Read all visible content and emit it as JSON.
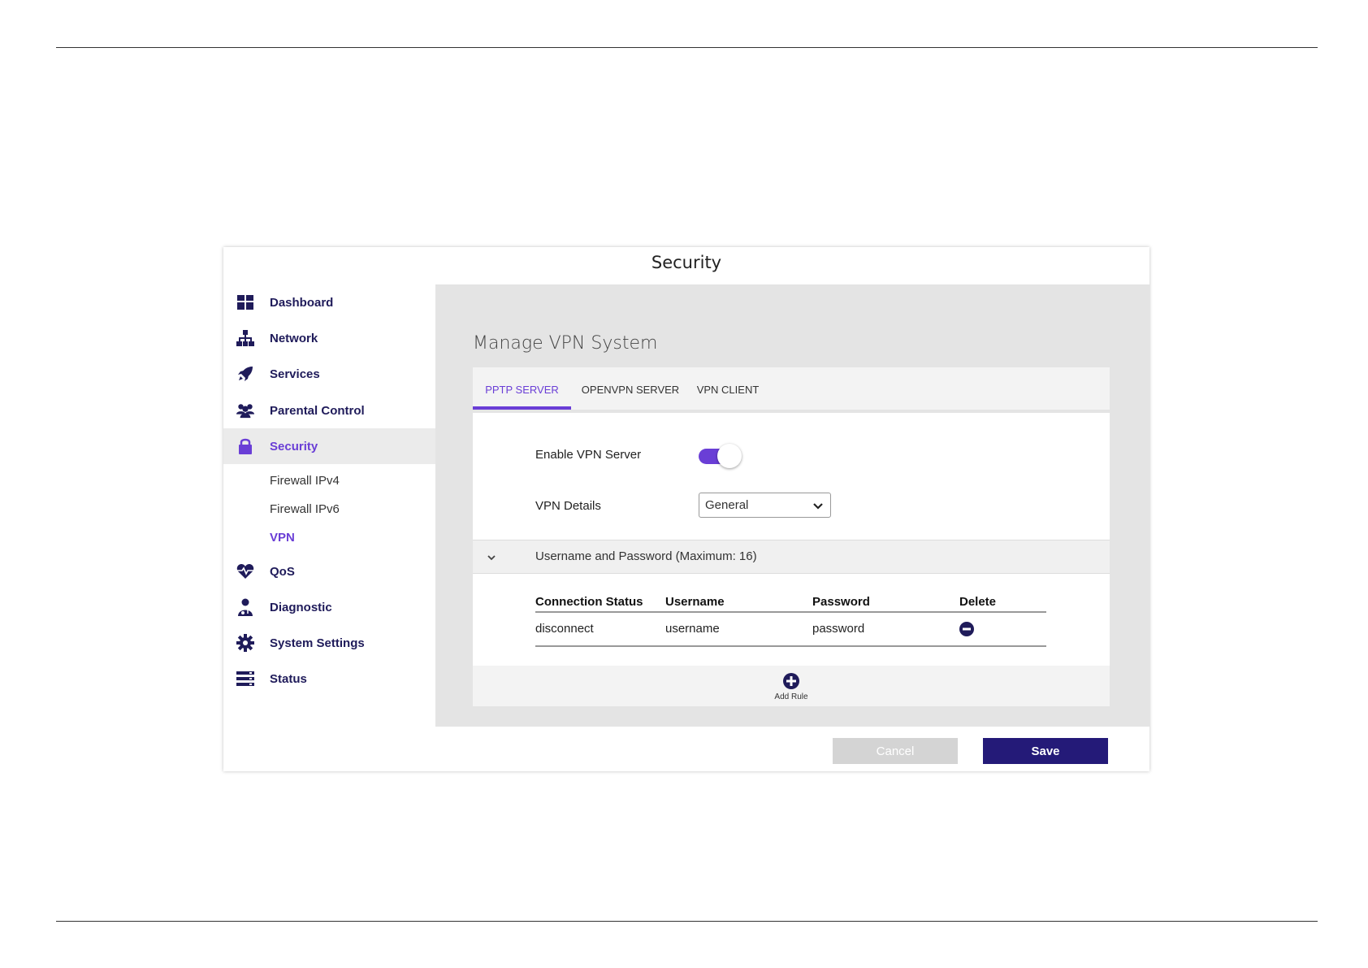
{
  "header": {
    "title": "Security"
  },
  "sidebar": {
    "items": [
      {
        "label": "Dashboard",
        "icon": "dashboard-icon"
      },
      {
        "label": "Network",
        "icon": "network-icon"
      },
      {
        "label": "Services",
        "icon": "rocket-icon"
      },
      {
        "label": "Parental Control",
        "icon": "users-icon"
      },
      {
        "label": "Security",
        "icon": "lock-icon",
        "active": true
      },
      {
        "label": "QoS",
        "icon": "heartbeat-icon"
      },
      {
        "label": "Diagnostic",
        "icon": "doctor-icon"
      },
      {
        "label": "System Settings",
        "icon": "gear-icon"
      },
      {
        "label": "Status",
        "icon": "server-icon"
      }
    ],
    "subitems": [
      {
        "label": "Firewall IPv4"
      },
      {
        "label": "Firewall IPv6"
      },
      {
        "label": "VPN",
        "active": true
      }
    ]
  },
  "main": {
    "title": "Manage VPN System",
    "tabs": [
      {
        "label": "PPTP SERVER",
        "active": true
      },
      {
        "label": "OPENVPN SERVER"
      },
      {
        "label": "VPN CLIENT"
      }
    ],
    "enable_label": "Enable VPN Server",
    "enable_on": true,
    "details_label": "VPN Details",
    "details_value": "General",
    "accordion_label": "Username and Password (Maximum: 16)",
    "table": {
      "headers": [
        "Connection Status",
        "Username",
        "Password",
        "Delete"
      ],
      "rows": [
        [
          "disconnect",
          "username",
          "password"
        ]
      ]
    },
    "add_rule_label": "Add Rule"
  },
  "footer": {
    "cancel_label": "Cancel",
    "save_label": "Save"
  },
  "colors": {
    "accent": "#6a3ed6",
    "nav_text": "#1f1b5a",
    "save_bg": "#241a78",
    "main_bg": "#e4e4e4"
  }
}
